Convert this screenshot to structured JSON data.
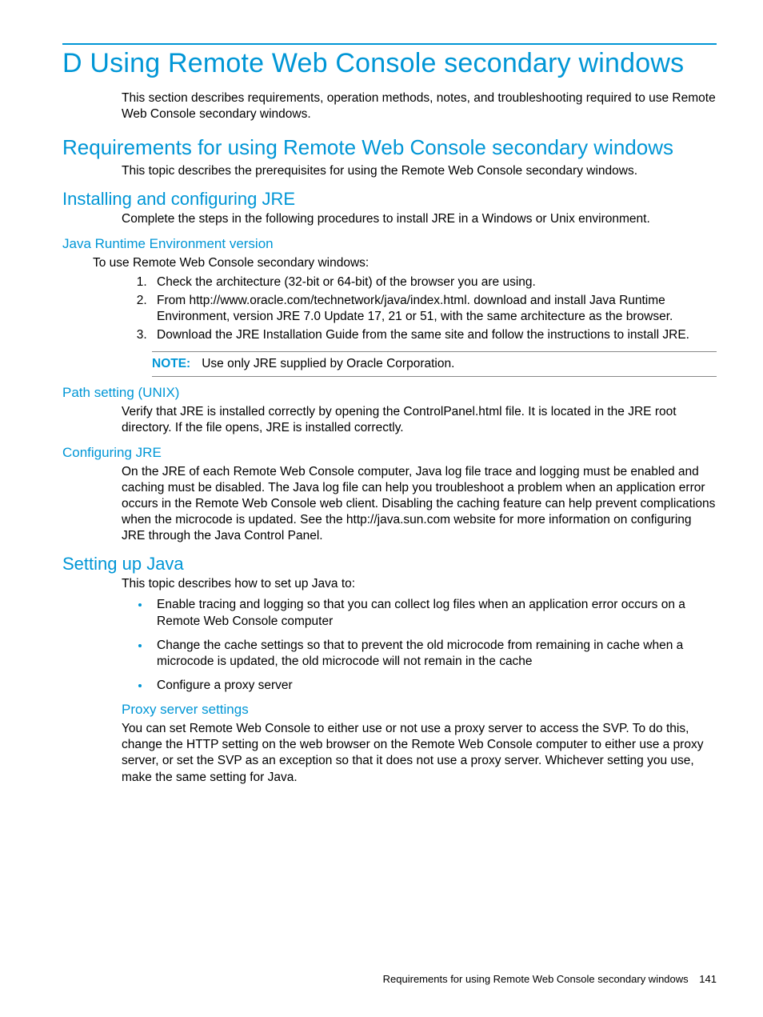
{
  "h1": "D Using Remote Web Console secondary windows",
  "intro": "This section describes requirements, operation methods, notes, and troubleshooting required to use Remote Web Console secondary windows.",
  "h2_req": "Requirements for using Remote Web Console secondary windows",
  "req_intro": "This topic describes the prerequisites for using the Remote Web Console secondary windows.",
  "h3_install": "Installing and configuring JRE",
  "install_intro": "Complete the steps in the following procedures to install JRE in a Windows or Unix environment.",
  "h4_jre_version": "Java Runtime Environment version",
  "jre_intro": "To use Remote Web Console secondary windows:",
  "ol": {
    "i1": "Check the architecture (32-bit or 64-bit) of the browser you are using.",
    "i2": "From http://www.oracle.com/technetwork/java/index.html. download and install Java Runtime Environment, version JRE 7.0 Update 17, 21 or 51, with the same architecture as the browser.",
    "i3": "Download the JRE Installation Guide from the same site and follow the instructions to install JRE."
  },
  "note_label": "NOTE:",
  "note_text": "Use only JRE supplied by Oracle Corporation.",
  "h4_path": "Path setting (UNIX)",
  "path_text": "Verify that JRE is installed correctly by opening the ControlPanel.html file. It is located in the JRE root directory. If the file opens, JRE is installed correctly.",
  "h4_conf": "Configuring JRE",
  "conf_text": "On the JRE of each Remote Web Console computer, Java log file trace and logging must be enabled and caching must be disabled. The Java log file can help you troubleshoot a problem when an application error occurs in the Remote Web Console web client. Disabling the caching feature can help prevent complications when the microcode is updated. See the http://java.sun.com website for more information on configuring JRE through the Java Control Panel.",
  "h3_java": "Setting up Java",
  "java_intro": "This topic describes how to set up Java to:",
  "ul": {
    "i1": "Enable tracing and logging so that you can collect log files when an application error occurs on a Remote Web Console computer",
    "i2": "Change the cache settings so that to prevent the old microcode from remaining in cache when a microcode is updated, the old microcode will not remain in the cache",
    "i3": "Configure a proxy server"
  },
  "h5_proxy": "Proxy server settings",
  "proxy_text": "You can set Remote Web Console to either use or not use a proxy server to access the SVP. To do this, change the HTTP setting on the web browser on the Remote Web Console computer to either use a proxy server, or set the SVP as an exception so that it does not use a proxy server. Whichever setting you use, make the same setting for Java.",
  "footer_text": "Requirements for using Remote Web Console secondary windows",
  "footer_page": "141"
}
